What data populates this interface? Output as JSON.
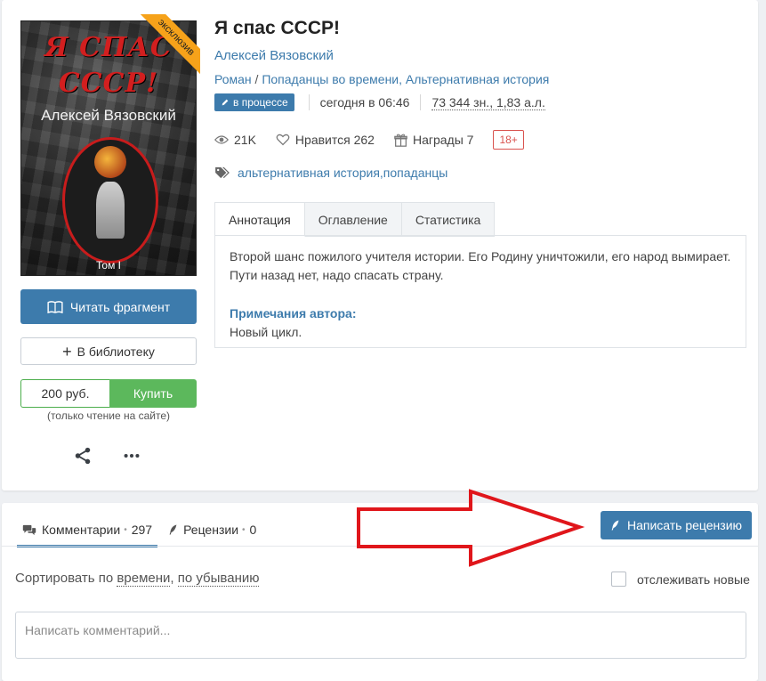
{
  "book": {
    "title": "Я спас СССР!",
    "author": "Алексей Вязовский",
    "genres": [
      "Роман",
      "Попаданцы во времени",
      "Альтернативная история"
    ],
    "genre_separator": " / ",
    "genre_comma": ", ",
    "status": "в процессе",
    "updated": "сегодня в 06:46",
    "size": "73 344 зн., 1,83 а.л.",
    "views": "21K",
    "likes_label": "Нравится",
    "likes": "262",
    "awards_label": "Награды",
    "awards": "7",
    "age": "18+",
    "tags": [
      "альтернативная история",
      "попаданцы"
    ],
    "tag_comma": ", "
  },
  "cover": {
    "title_line1": "Я СПАС",
    "title_line2": "СССР!",
    "author": "Алексей Вязовский",
    "volume": "Том I",
    "ribbon": "эксклюзив"
  },
  "actions": {
    "read": "Читать фрагмент",
    "library": "В библиотеку",
    "price": "200 руб.",
    "buy": "Купить",
    "note": "(только чтение на сайте)"
  },
  "tabs": [
    "Аннотация",
    "Оглавление",
    "Статистика"
  ],
  "annotation": {
    "text": "Второй шанс пожилого учителя истории. Его Родину уничтожили, его народ вымирает. Пути назад нет, надо спасать страну.",
    "notes_title": "Примечания автора:",
    "notes_text": "Новый цикл."
  },
  "discussion": {
    "comments_label": "Комментарии",
    "comments_dot": "•",
    "comments_count": "297",
    "reviews_label": "Рецензии",
    "reviews_dot": "•",
    "reviews_count": "0",
    "write_review": "Написать рецензию",
    "sort_prefix": "Сортировать по ",
    "sort_field": "времени",
    "sort_comma": ", ",
    "sort_order": "по убыванию",
    "track_label": "отслеживать новые",
    "comment_placeholder": "Написать комментарий..."
  },
  "colors": {
    "accent": "#3d7bac",
    "buy": "#5cb85c",
    "ribbon": "#f6a21a",
    "arrow": "#e0161b"
  }
}
